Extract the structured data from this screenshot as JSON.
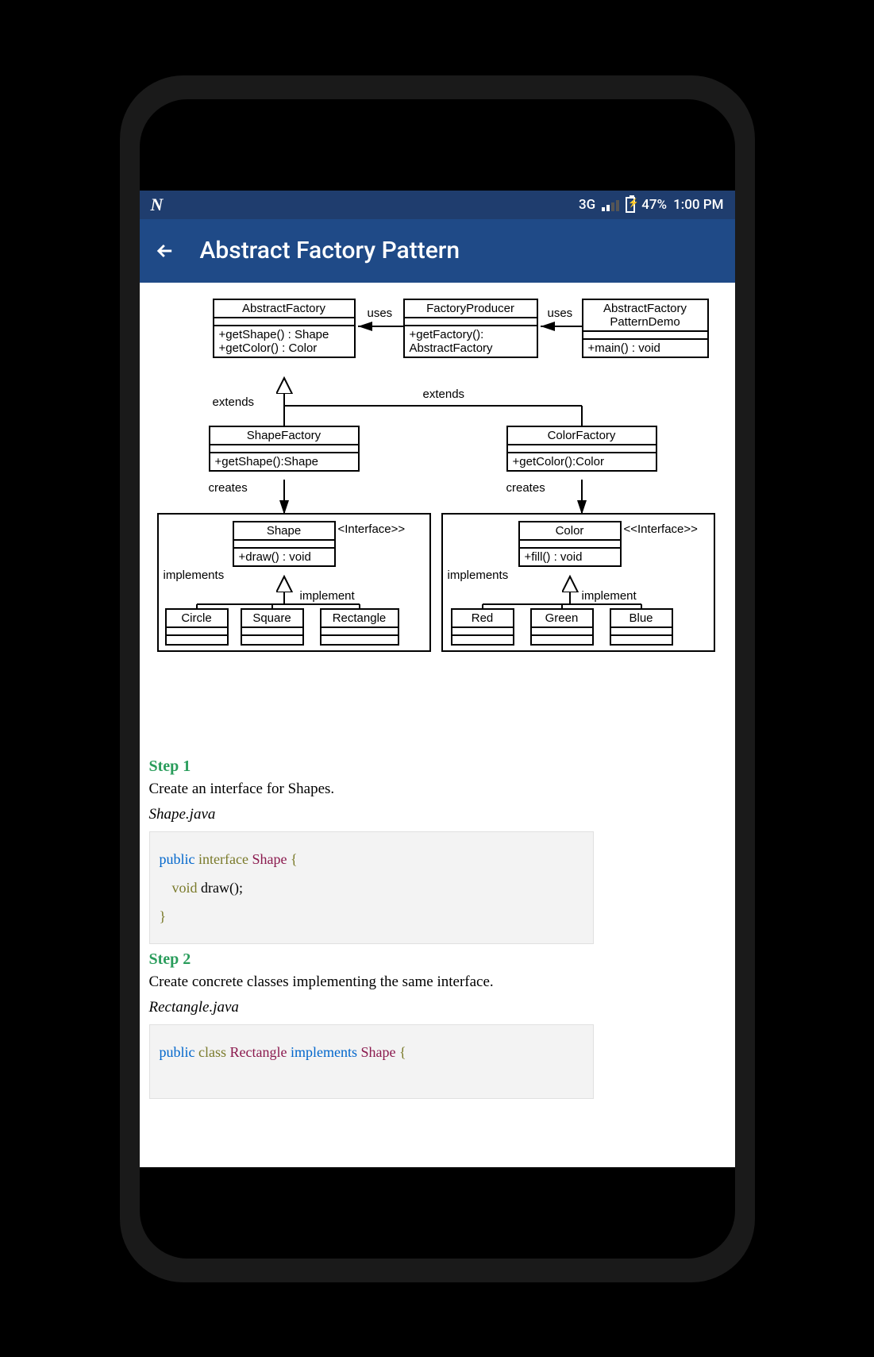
{
  "statusBar": {
    "network": "3G",
    "battery": "47%",
    "time": "1:00 PM"
  },
  "appBar": {
    "title": "Abstract Factory Pattern"
  },
  "diagram": {
    "abstractFactory": {
      "name": "AbstractFactory",
      "methods": "+getShape() : Shape\n+getColor() : Color"
    },
    "factoryProducer": {
      "name": "FactoryProducer",
      "methods": "+getFactory():\nAbstractFactory"
    },
    "demo": {
      "name": "AbstractFactory\nPatternDemo",
      "methods": "+main() : void"
    },
    "shapeFactory": {
      "name": "ShapeFactory",
      "methods": "+getShape():Shape"
    },
    "colorFactory": {
      "name": "ColorFactory",
      "methods": "+getColor():Color"
    },
    "shape": {
      "name": "Shape",
      "stereotype": "<Interface>>",
      "methods": "+draw() : void"
    },
    "color": {
      "name": "Color",
      "stereotype": "<<Interface>>",
      "methods": "+fill() : void"
    },
    "circle": "Circle",
    "square": "Square",
    "rectangle": "Rectangle",
    "red": "Red",
    "green": "Green",
    "blue": "Blue",
    "labels": {
      "uses1": "uses",
      "uses2": "uses",
      "extends1": "extends",
      "extends2": "extends",
      "creates1": "creates",
      "creates2": "creates",
      "implements1": "implements",
      "implements2": "implements",
      "implement1": "implement",
      "implement2": "implement"
    }
  },
  "step1": {
    "label": "Step 1",
    "text": "Create an interface for Shapes.",
    "filename": "Shape.java",
    "code": {
      "l1_public": "public",
      "l1_interface": "interface",
      "l1_type": "Shape",
      "l1_brace": "{",
      "l2_void": "void",
      "l2_method": "draw();",
      "l3_brace": "}"
    }
  },
  "step2": {
    "label": "Step 2",
    "text": "Create concrete classes implementing the same interface.",
    "filename": "Rectangle.java",
    "code": {
      "l1_public": "public",
      "l1_class": "class",
      "l1_type": "Rectangle",
      "l1_implements": "implements",
      "l1_type2": "Shape",
      "l1_brace": "{"
    }
  }
}
